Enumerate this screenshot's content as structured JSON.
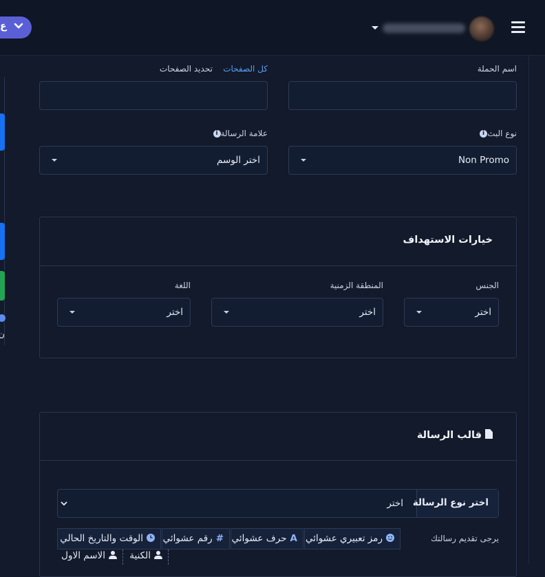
{
  "header": {
    "language_pill": "ع",
    "icons": {
      "menu": "hamburger-icon",
      "user_dropdown": "caret-down-icon",
      "language_chevron": "chevron-down-icon"
    }
  },
  "form": {
    "campaign_name": {
      "label": "اسم الحملة",
      "value": ""
    },
    "pages": {
      "label": "تحديد الصفحات",
      "all_pages_link": "كل الصفحات",
      "value": ""
    },
    "broadcast_type": {
      "label": "نوع البث",
      "selected": "Non Promo"
    },
    "message_tag": {
      "label": "علامة الرسالة",
      "selected": "اختر الوسم"
    }
  },
  "targeting": {
    "title": "خيارات الاستهداف",
    "gender": {
      "label": "الجنس",
      "selected": "اختر"
    },
    "timezone": {
      "label": "المنطقة الزمنية",
      "selected": "اختر"
    },
    "language": {
      "label": "اللغة",
      "selected": "اختر"
    }
  },
  "template": {
    "title": "قالب الرسالة",
    "message_type": {
      "label": "اختر نوع الرسالة",
      "selected": "اختر"
    },
    "intro_label": "يرجى تقديم رسالتك",
    "placeholders": [
      {
        "label": "رمز تعبيري عشوائي",
        "icon": "smile-icon"
      },
      {
        "label": "حرف عشوائي",
        "icon": "letter-a-icon"
      },
      {
        "label": "رقم عشوائي",
        "icon": "hash-icon"
      },
      {
        "label": "الوقت والتاريخ الحالي",
        "icon": "clock-icon"
      }
    ],
    "name_placeholders": [
      {
        "label": "الكنية",
        "icon": "user-icon"
      },
      {
        "label": "الاسم الاول",
        "icon": "user-icon"
      }
    ]
  },
  "colors": {
    "accent": "#1672f3",
    "link": "#5b9cf6",
    "success": "#23a455",
    "pill": "#5b5fd6",
    "background": "#121a2b"
  }
}
